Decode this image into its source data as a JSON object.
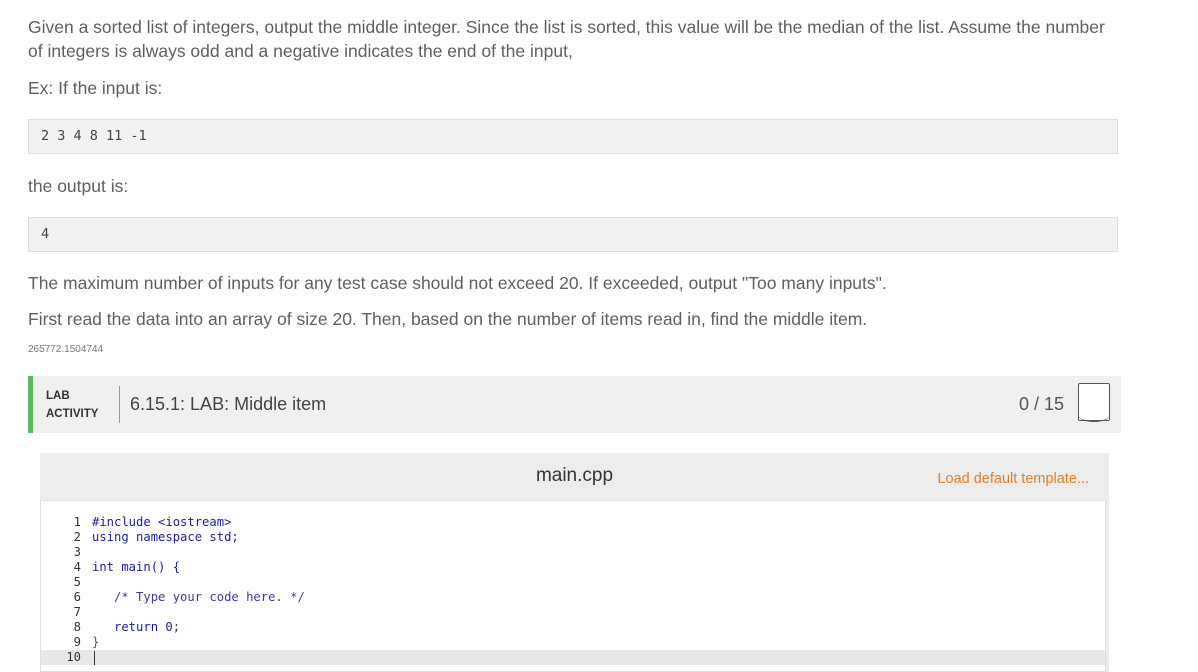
{
  "problem": {
    "intro": "Given a sorted list of integers, output the middle integer. Since the list is sorted, this value will be the median of the list. Assume the number of integers is always odd and a negative indicates the end of the input,",
    "example_label": "Ex: If the input is:",
    "example_input": "2 3 4 8 11 -1",
    "output_label": "the output is:",
    "example_output": "4",
    "max_inputs_note": "The maximum number of inputs for any test case should not exceed 20. If exceeded, output \"Too many inputs\".",
    "instruction": "First read the data into an array of size 20. Then, based on the number of items read in, find the middle item.",
    "id_code": "265772.1504744"
  },
  "lab": {
    "tag_line1": "LAB",
    "tag_line2": "ACTIVITY",
    "title": "6.15.1: LAB: Middle item",
    "score": "0 / 15",
    "accent_color": "#5cb85c"
  },
  "editor": {
    "file_name": "main.cpp",
    "load_default": "Load default template...",
    "load_default_color": "#e67e22",
    "lines": [
      {
        "num": "1",
        "text": "#include <iostream>"
      },
      {
        "num": "2",
        "text": "using namespace std;"
      },
      {
        "num": "3",
        "text": ""
      },
      {
        "num": "4",
        "text": "int main() {"
      },
      {
        "num": "5",
        "text": ""
      },
      {
        "num": "6",
        "text": "   /* Type your code here. */"
      },
      {
        "num": "7",
        "text": ""
      },
      {
        "num": "8",
        "text": "   return 0;"
      },
      {
        "num": "9",
        "text": "}"
      },
      {
        "num": "10",
        "text": ""
      }
    ]
  }
}
